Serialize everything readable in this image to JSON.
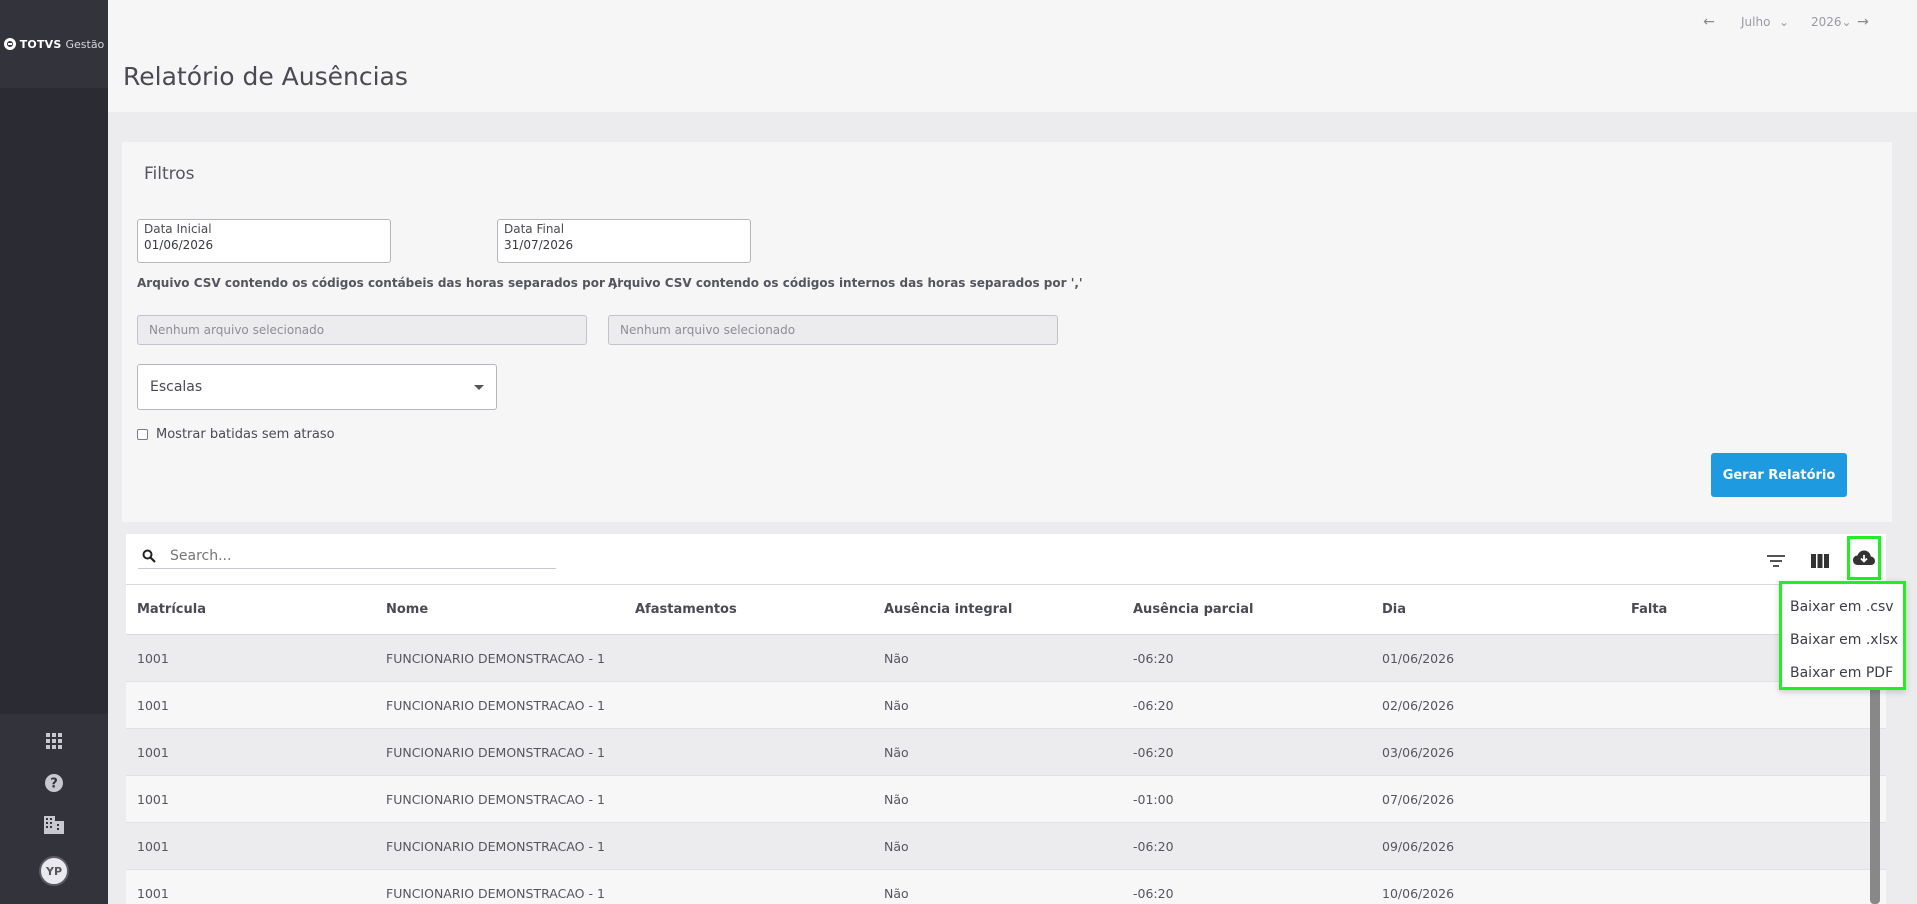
{
  "app": {
    "logo_brand": "TOTVS",
    "logo_product": "Gestão"
  },
  "sidebar": {
    "avatar_initials": "YP",
    "icons": [
      "apps-grid-icon",
      "help-icon",
      "company-icon"
    ]
  },
  "header": {
    "title": "Relatório de Ausências",
    "month": "Julho",
    "year": "2026"
  },
  "filters": {
    "title": "Filtros",
    "start_date": {
      "label": "Data Inicial",
      "value": "01/06/2026"
    },
    "end_date": {
      "label": "Data Final",
      "value": "31/07/2026"
    },
    "csv_accounting": {
      "label": "Arquivo CSV contendo os códigos contábeis das horas separados por ','",
      "placeholder": "Nenhum arquivo selecionado"
    },
    "csv_internal": {
      "label": "Arquivo CSV contendo os códigos internos das horas separados por ','",
      "placeholder": "Nenhum arquivo selecionado"
    },
    "scales_select": "Escalas",
    "checkbox_label": "Mostrar batidas sem atraso",
    "generate_button": "Gerar Relatório"
  },
  "table": {
    "search_placeholder": "Search...",
    "columns": [
      "Matrícula",
      "Nome",
      "Afastamentos",
      "Ausência integral",
      "Ausência parcial",
      "Dia",
      "Falta"
    ],
    "rows": [
      [
        "1001",
        "FUNCIONARIO DEMONSTRACAO - 1",
        "",
        "Não",
        "-06:20",
        "01/06/2026",
        ""
      ],
      [
        "1001",
        "FUNCIONARIO DEMONSTRACAO - 1",
        "",
        "Não",
        "-06:20",
        "02/06/2026",
        ""
      ],
      [
        "1001",
        "FUNCIONARIO DEMONSTRACAO - 1",
        "",
        "Não",
        "-06:20",
        "03/06/2026",
        ""
      ],
      [
        "1001",
        "FUNCIONARIO DEMONSTRACAO - 1",
        "",
        "Não",
        "-01:00",
        "07/06/2026",
        ""
      ],
      [
        "1001",
        "FUNCIONARIO DEMONSTRACAO - 1",
        "",
        "Não",
        "-06:20",
        "09/06/2026",
        ""
      ],
      [
        "1001",
        "FUNCIONARIO DEMONSTRACAO - 1",
        "",
        "Não",
        "-06:20",
        "10/06/2026",
        ""
      ]
    ]
  },
  "download_menu": {
    "items": [
      "Baixar em .csv",
      "Baixar em .xlsx",
      "Baixar em PDF"
    ]
  },
  "colors": {
    "primary": "#1e9ae0",
    "sidebar": "#2b2b33",
    "highlight": "#22ee22"
  }
}
